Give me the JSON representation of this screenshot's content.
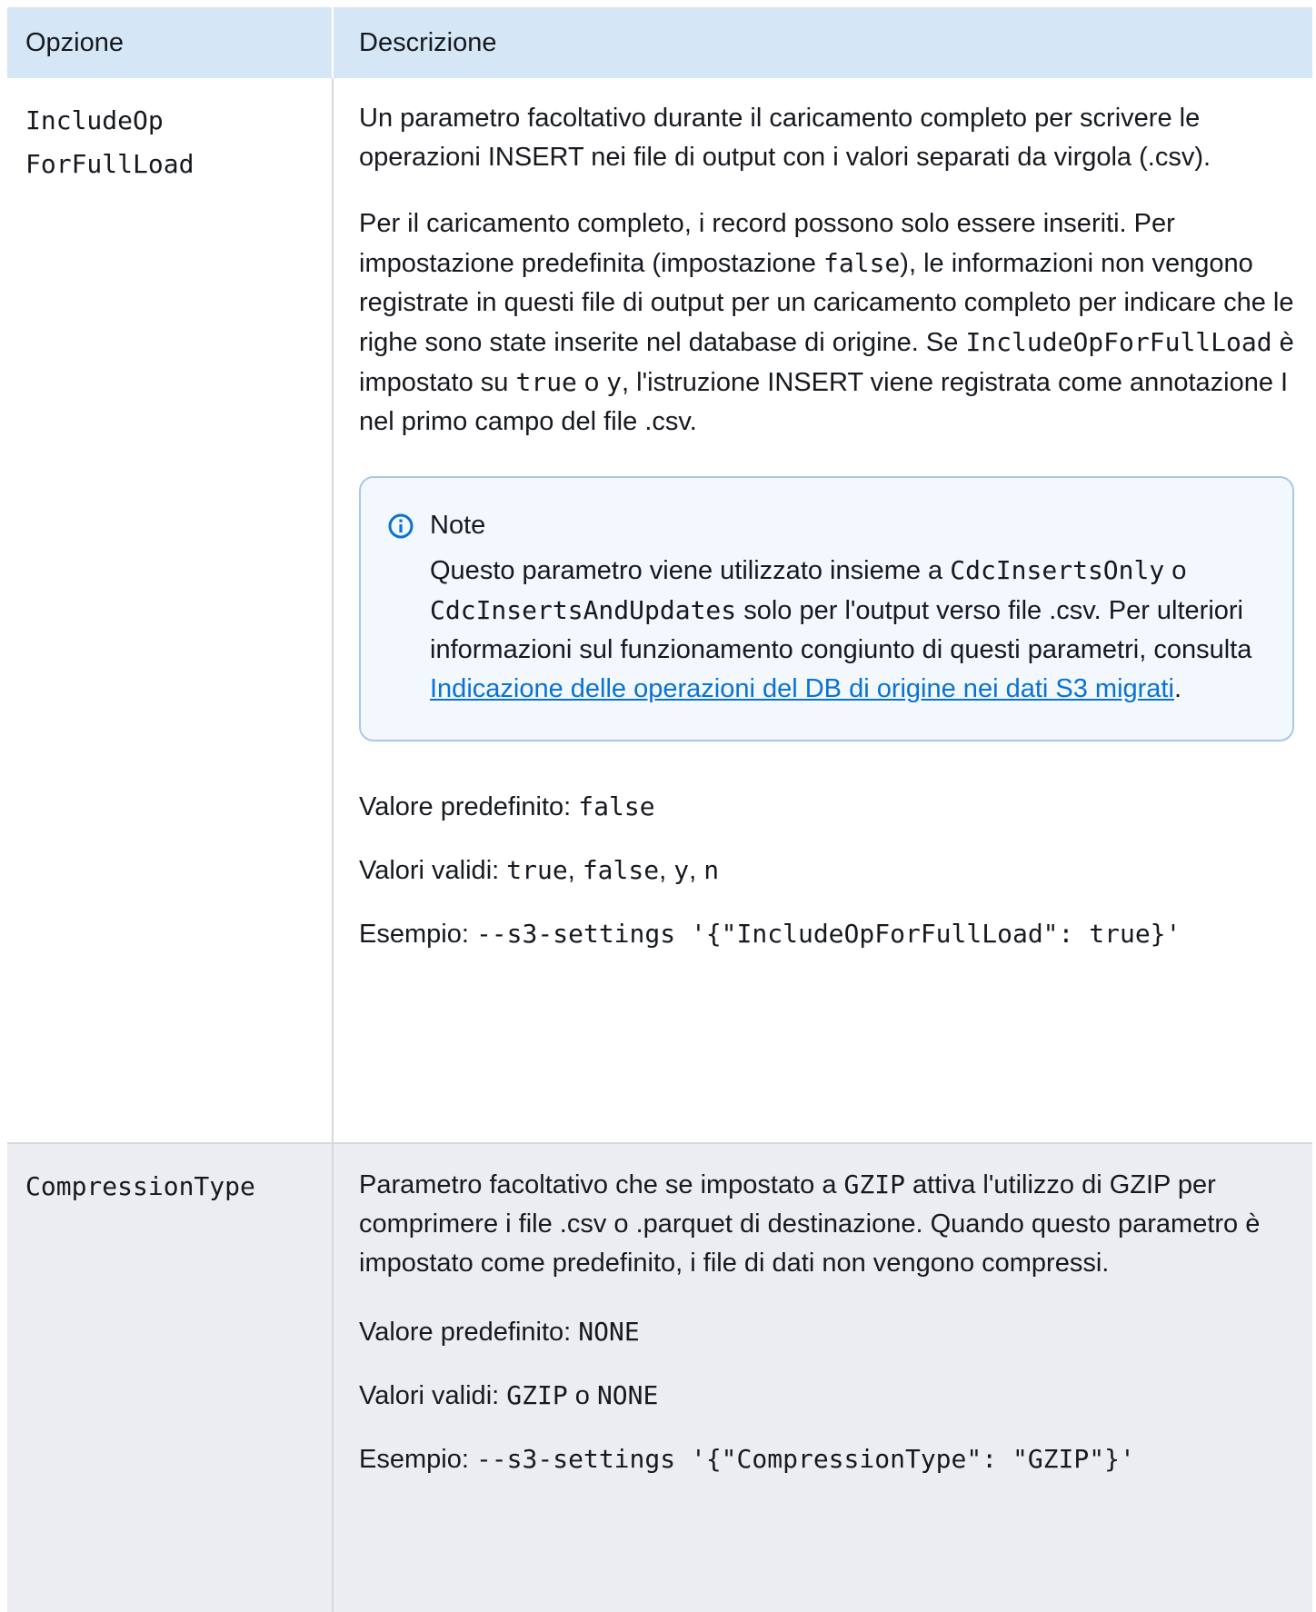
{
  "table": {
    "headers": [
      "Opzione",
      "Descrizione"
    ],
    "rows": [
      {
        "option": "IncludeOpForFullLoad",
        "option_line1": "IncludeOp",
        "option_line2": "ForFullLoad",
        "p1": "Un parametro facoltativo durante il caricamento completo per scrivere le operazioni INSERT nei file di output con i valori separati da virgola (.csv).",
        "p2": {
          "t1": "Per il caricamento completo, i record possono solo essere inseriti. Per impostazione predefinita (impostazione ",
          "c1": "false",
          "t2": "), le informazioni non vengono registrate in questi file di output per un caricamento completo per indicare che le righe sono state inserite nel database di origine. Se ",
          "c2": "IncludeOpForFullLoad",
          "t3": " è impostato su ",
          "c3": "true",
          "t4": " o ",
          "c4": "y",
          "t5": ", l'istruzione INSERT viene registrata come annotazione I nel primo campo del file .csv."
        },
        "note": {
          "title": "Note",
          "t1": "Questo parametro viene utilizzato insieme a ",
          "c1": "CdcInsertsOnly",
          "t2": " o ",
          "c2": "CdcInsertsAndUpdates",
          "t3": " solo per l'output verso file .csv. Per ulteriori informazioni sul funzionamento congiunto di questi parametri, consulta ",
          "link": "Indicazione delle operazioni del DB di origine nei dati S3 migrati",
          "t4": "."
        },
        "default_label": "Valore predefinito: ",
        "default_value": "false",
        "valid_label": "Valori validi: ",
        "valid_values": [
          "true",
          "false",
          "y",
          "n"
        ],
        "sep": ", ",
        "example_label": "Esempio: ",
        "example_value": "--s3-settings '{\"IncludeOpForFullLoad\": true}'"
      },
      {
        "option": "CompressionType",
        "desc": {
          "t1": "Parametro facoltativo che se impostato a ",
          "c1": "GZIP",
          "t2": " attiva l'utilizzo di GZIP per comprimere i file .csv o .parquet di destinazione. Quando questo parametro è impostato come predefinito, i file di dati non vengono compressi."
        },
        "default_label": "Valore predefinito: ",
        "default_value": "NONE",
        "valid_label": "Valori validi: ",
        "valid_a": "GZIP",
        "valid_or": " o ",
        "valid_b": "NONE",
        "example_label": "Esempio: ",
        "example_value": "--s3-settings '{\"CompressionType\": \"GZIP\"}'"
      }
    ]
  },
  "colors": {
    "header_bg": "#d5e6f6",
    "row2_bg": "#ebedf0",
    "note_border": "#a7c8e6",
    "link": "#0972d3"
  },
  "icons": {
    "note": "info-icon"
  }
}
